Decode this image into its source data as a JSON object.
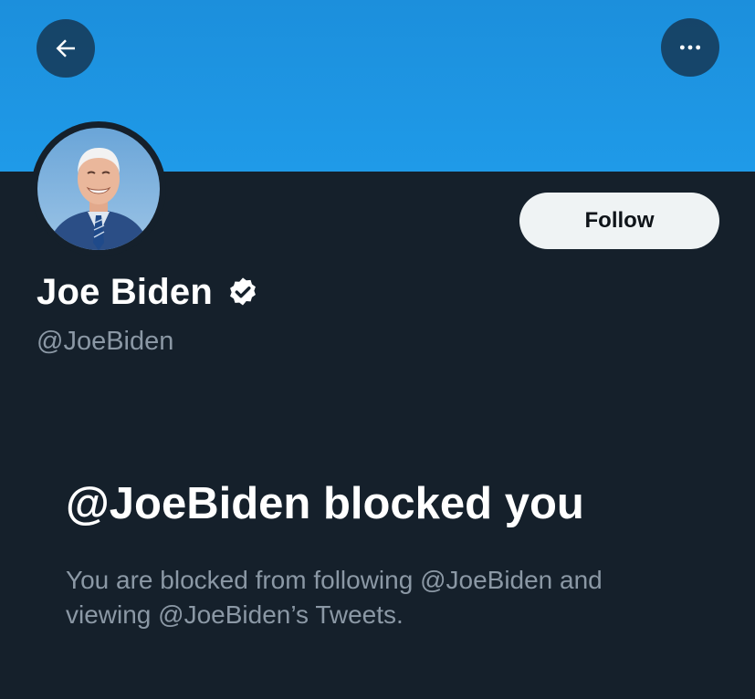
{
  "header": {
    "back_icon": "arrow-left-icon",
    "more_icon": "more-horizontal-icon"
  },
  "profile": {
    "name": "Joe Biden",
    "handle": "@JoeBiden",
    "verified_icon": "verified-badge-icon",
    "follow_label": "Follow"
  },
  "blocked": {
    "title": "@JoeBiden blocked you",
    "line1": "You are blocked from following @JoeBiden and",
    "line2": "viewing @JoeBiden’s Tweets."
  },
  "colors": {
    "banner": "#1d9bf0",
    "background": "#15202b",
    "secondary_text": "#8b98a5",
    "button_bg": "#eff3f4"
  }
}
